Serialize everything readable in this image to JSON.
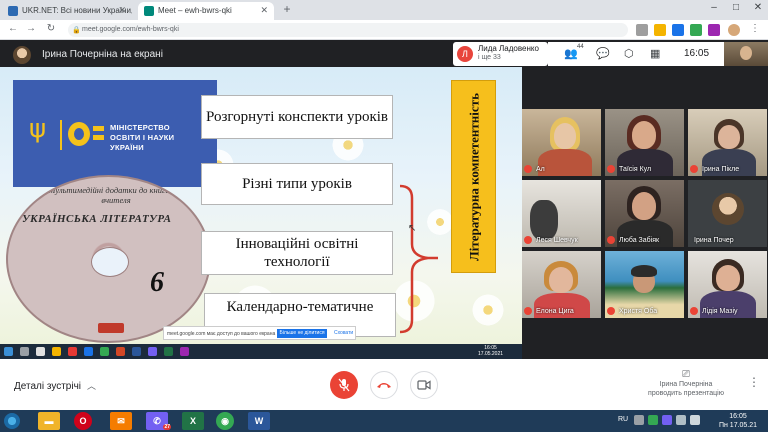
{
  "browser": {
    "tabs": [
      {
        "title": "UKR.NET: Всі новини України, с",
        "favicon_color": "#2d6ab2",
        "active": false
      },
      {
        "title": "Meet – ewh-bwrs-qki",
        "favicon_color": "#00897b",
        "active": true
      }
    ],
    "new_tab": "+",
    "url": "meet.google.com/ewh-bwrs-qki"
  },
  "meet": {
    "presenter_text": "Ірина Почерніна на екрані",
    "pinned": {
      "initial": "Л",
      "name": "Лида Ладовенко",
      "subtitle": "і ще 33"
    },
    "participants_count": "44",
    "time": "16:05"
  },
  "slide": {
    "ministry_text": [
      "МІНІСТЕРСТВО",
      "ОСВІТИ І НАУКИ",
      "УКРАЇНИ"
    ],
    "book_subtitle": "Мультимедійні додатки до книги для вчителя",
    "book_title": "УКРАЇНСЬКА ЛІТЕРАТУРА",
    "book_grade": "6",
    "boxes": [
      "Розгорнуті конспекти уроків",
      "Різні типи уроків",
      "Інноваційні освітні технології",
      "Календарно-тематичне"
    ],
    "competence": "Літературна компетентність",
    "share_banner": {
      "text": "meet.google.com має доступ до вашого екрана",
      "stop": "Більше не ділитися",
      "hide": "Сховати"
    },
    "inner_clock": [
      "16:05",
      "17.05.2021"
    ]
  },
  "participants": [
    {
      "name": "Ал",
      "muted": true
    },
    {
      "name": "Таїсія Кул",
      "muted": true
    },
    {
      "name": "Ірина Пікле",
      "muted": true
    },
    {
      "name": "Леся Шевчук",
      "muted": true
    },
    {
      "name": "Люба Забіяк",
      "muted": true
    },
    {
      "name": "Ірина Почер",
      "muted": false
    },
    {
      "name": "Елона Цига",
      "muted": true
    },
    {
      "name": "Христя Оба",
      "muted": true
    },
    {
      "name": "Лідія Мазіу",
      "muted": true
    }
  ],
  "bottom": {
    "details": "Деталі зустрічі",
    "presenting": [
      "Ірина Почерніна",
      "проводить презентацію"
    ]
  },
  "taskbar": {
    "viber_badge": "27",
    "language": "RU",
    "time": "16:05",
    "date": "Пн 17.05.21"
  },
  "colors": {
    "end_call": "#ea4335",
    "meet_bg": "#202124",
    "competence_box": "#f6bf1c",
    "ministry_blue": "#3c5db0"
  }
}
